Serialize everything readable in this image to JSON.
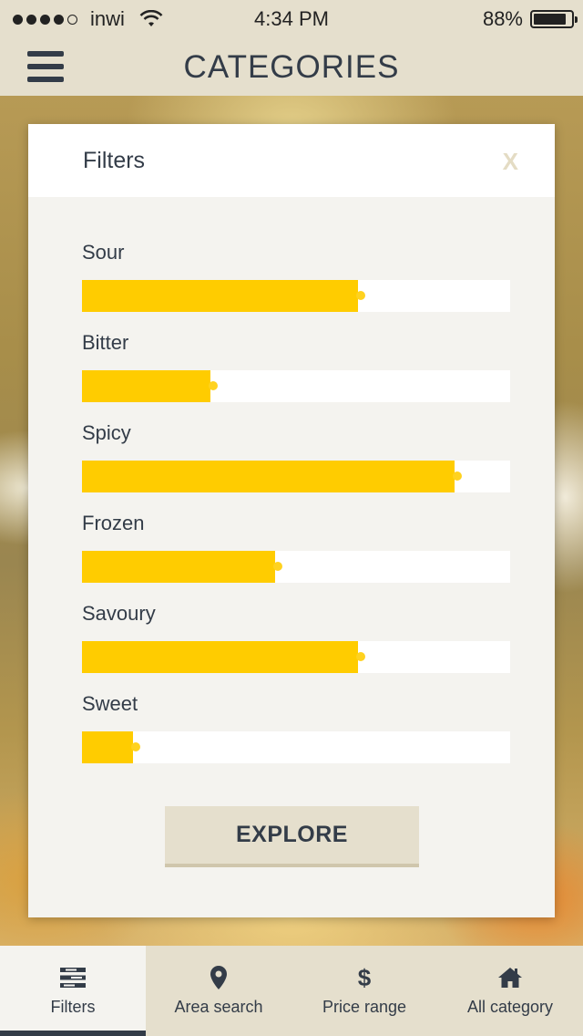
{
  "status_bar": {
    "carrier": "inwi",
    "time": "4:34 PM",
    "battery": "88%",
    "battery_level": 0.88,
    "signal_bars": 4,
    "signal_total": 5
  },
  "navbar": {
    "title": "CATEGORIES",
    "menu_icon": "hamburger-menu-icon"
  },
  "modal": {
    "title": "Filters",
    "close_label": "X",
    "filters": [
      {
        "label": "Sour",
        "value": 0.645
      },
      {
        "label": "Bitter",
        "value": 0.3
      },
      {
        "label": "Spicy",
        "value": 0.87
      },
      {
        "label": "Frozen",
        "value": 0.45
      },
      {
        "label": "Savoury",
        "value": 0.645
      },
      {
        "label": "Sweet",
        "value": 0.12
      }
    ],
    "explore_label": "EXPLORE"
  },
  "tabs": [
    {
      "label": "Filters",
      "icon": "filters-icon",
      "active": true
    },
    {
      "label": "Area search",
      "icon": "location-pin-icon",
      "active": false
    },
    {
      "label": "Price range",
      "icon": "dollar-icon",
      "active": false
    },
    {
      "label": "All category",
      "icon": "home-icon",
      "active": false
    }
  ],
  "colors": {
    "accent": "#ffcc00",
    "bar_bg": "#e5dfcd",
    "text": "#333c48"
  }
}
